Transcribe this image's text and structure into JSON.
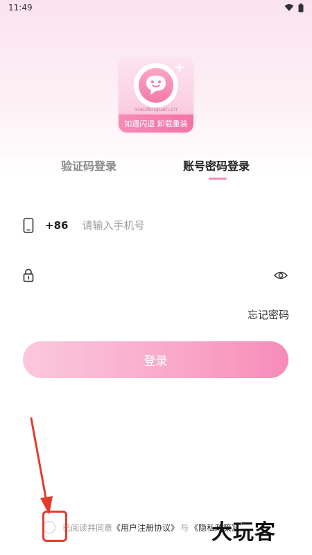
{
  "status_bar": {
    "time": "11:49",
    "icons": [
      "wifi-icon",
      "battery-icon"
    ]
  },
  "logo": {
    "domain": "xiaofenquan.cn",
    "slogan": "如遇闪退 卸载重装"
  },
  "tabs": [
    {
      "label": "验证码登录",
      "active": false
    },
    {
      "label": "账号密码登录",
      "active": true
    }
  ],
  "phone": {
    "country_code": "+86",
    "placeholder": "请输入手机号",
    "value": ""
  },
  "password": {
    "placeholder": "",
    "value": ""
  },
  "forgot_label": "忘记密码",
  "login_label": "登录",
  "agreement": {
    "prefix": "已阅读并同意",
    "user_agreement": "《用户注册协议》",
    "conjunction": "与",
    "privacy_policy": "《隐私政策》"
  },
  "watermark": "大玩客",
  "colors": {
    "accent": "#f58cb8",
    "annotation": "#e53b2c"
  }
}
